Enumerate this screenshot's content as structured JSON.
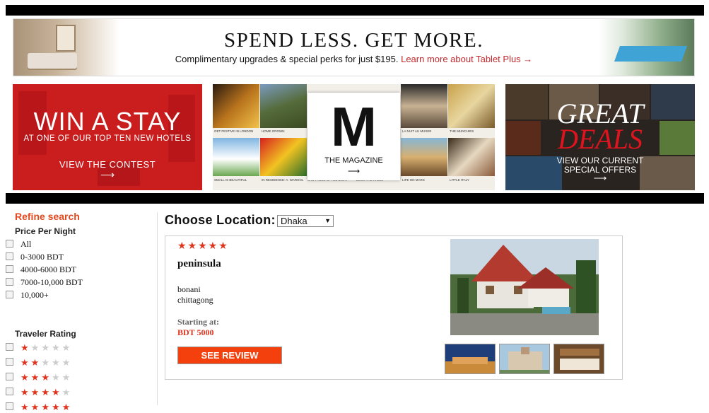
{
  "top_banner": {
    "title": "SPEND LESS. GET MORE.",
    "subtitle": "Complimentary upgrades & special perks for just $195.",
    "link": "Learn more about Tablet Plus →"
  },
  "promo_win": {
    "headline": "WIN A STAY",
    "line": "AT ONE OF OUR TOP TEN NEW HOTELS",
    "cta": "VIEW THE CONTEST",
    "arrow": "⟶"
  },
  "promo_magazine": {
    "logo": "M",
    "label": "THE MAGAZINE",
    "arrow": "⟶",
    "tile_captions": [
      "GET FESTIVE IN LONDON",
      "HOME GROWN",
      "LA NUIT AU MUSEE",
      "THE MUNCHIES",
      "SMALL IS BEAUTIFUL",
      "IN RESIDENCE: A. WARHOL",
      "SAO PAULO UP ALL NIGHT",
      "DECK THE HALLS",
      "LIFE ON MARS",
      "LITTLE ITALY"
    ]
  },
  "promo_deals": {
    "great": "GREAT",
    "deals": "DEALS",
    "line1": "VIEW OUR CURRENT",
    "line2": "SPECIAL OFFERS",
    "arrow": "⟶"
  },
  "sidebar": {
    "refine_title": "Refine search",
    "price_title": "Price Per Night",
    "price_options": [
      "All",
      "0-3000 BDT",
      "4000-6000 BDT",
      "7000-10,000 BDT",
      "10,000+"
    ],
    "rating_title": "Traveler Rating",
    "rating_options": [
      1,
      2,
      3,
      4,
      5
    ]
  },
  "location": {
    "label": "Choose Location:",
    "selected": "Dhaka"
  },
  "hotel": {
    "stars": "★★★★★",
    "name": "peninsula",
    "address_line1": "bonani",
    "address_line2": "chittagong",
    "starting_label": "Starting at:",
    "price": "BDT 5000",
    "review_button": "SEE REVIEW"
  },
  "colors": {
    "accent": "#e0341e",
    "button": "#f4400c",
    "promo_red": "#c4191b"
  }
}
